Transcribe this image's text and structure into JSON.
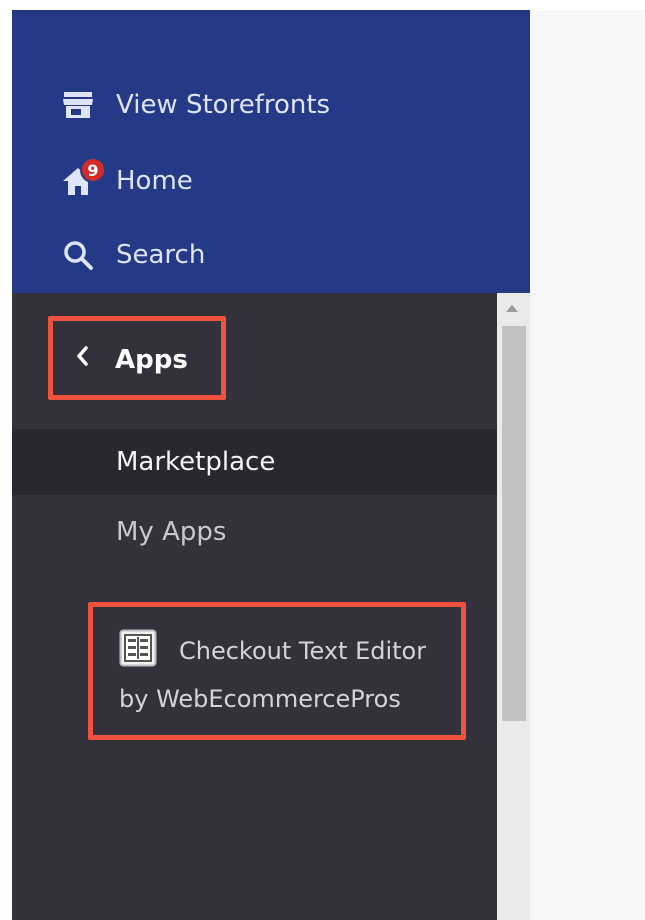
{
  "top_nav": {
    "storefronts": {
      "label": "View Storefronts",
      "icon": "storefront-icon"
    },
    "home": {
      "label": "Home",
      "icon": "home-icon",
      "badge_count": "9"
    },
    "search": {
      "label": "Search",
      "icon": "search-icon"
    }
  },
  "apps_panel": {
    "back_label": "Apps",
    "back_icon": "chevron-left-icon",
    "items": [
      {
        "label": "Marketplace",
        "selected": true
      },
      {
        "label": "My Apps",
        "selected": false
      }
    ],
    "installed_app": {
      "name_line1": "Checkout Text Editor",
      "name_line2": "by WebEcommercePros",
      "icon": "app-logo-icon"
    }
  },
  "colors": {
    "nav_blue": "#253a87",
    "panel_dark": "#33313b",
    "highlight_border": "#f0523d",
    "badge_red": "#d22b2b"
  }
}
